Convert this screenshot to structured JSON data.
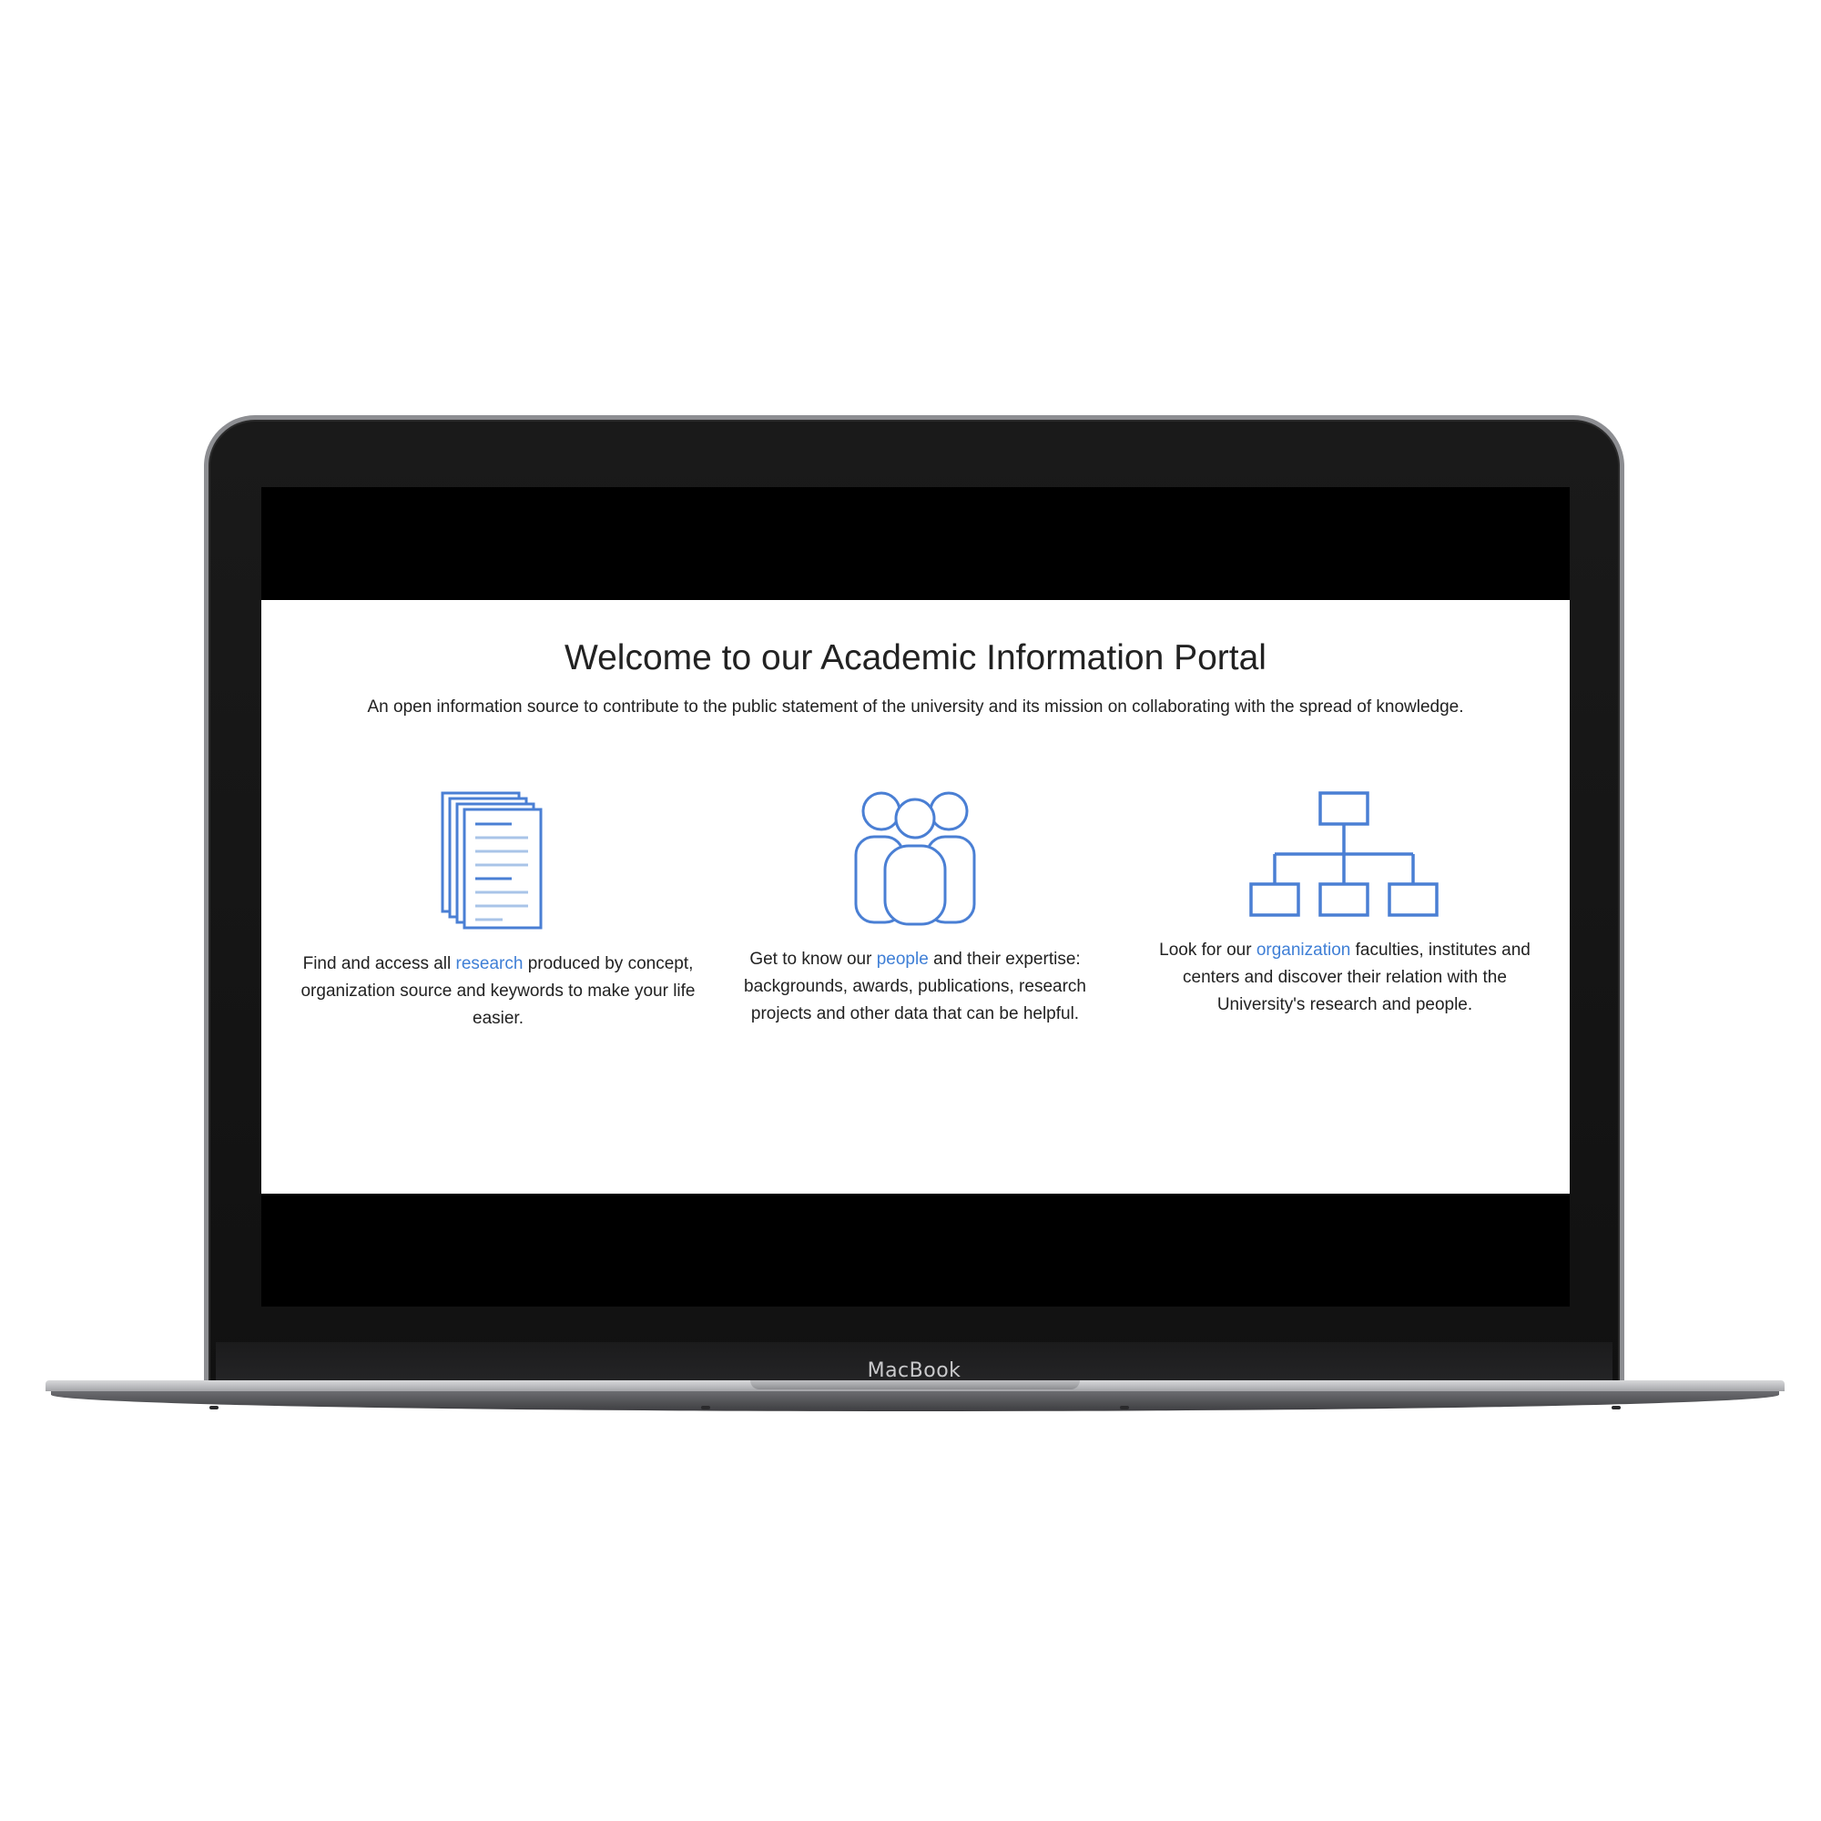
{
  "device": {
    "brand_label": "MacBook"
  },
  "portal": {
    "title": "Welcome to our Academic Information Portal",
    "subtitle": "An open information source to contribute to the public statement of the university and its mission on collaborating with the spread of knowledge.",
    "features": [
      {
        "icon": "documents-icon",
        "text_before": "Find and access all ",
        "link_label": "research",
        "text_after": " produced by concept, organization source and keywords to make your life easier."
      },
      {
        "icon": "people-icon",
        "text_before": "Get to know our ",
        "link_label": "people",
        "text_after": " and their expertise: backgrounds, awards, publications, research projects and other data that can be helpful."
      },
      {
        "icon": "org-chart-icon",
        "text_before": "Look for our ",
        "link_label": "organization",
        "text_after": " faculties, institutes and centers and discover their relation with the University's research and people."
      }
    ]
  },
  "colors": {
    "accent": "#3f7fd6",
    "icon_stroke": "#4a7fd4",
    "icon_light": "#a9c4e8",
    "text": "#222222"
  }
}
